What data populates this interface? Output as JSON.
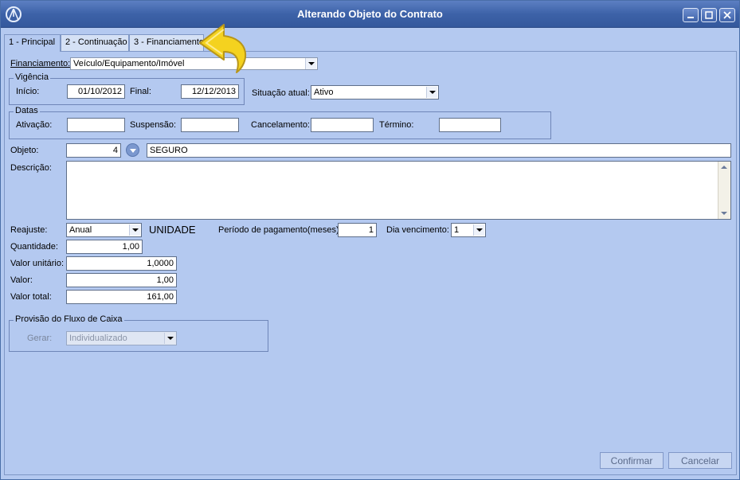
{
  "window": {
    "title": "Alterando Objeto do Contrato"
  },
  "tabs": [
    {
      "label": "1 - Principal"
    },
    {
      "label": "2 - Continuação"
    },
    {
      "label": "3 - Financiamento"
    }
  ],
  "financiamento": {
    "label": "Financiamento:",
    "value": "Veículo/Equipamento/Imóvel"
  },
  "vigencia": {
    "title": "Vigência",
    "inicio_label": "Início:",
    "inicio_value": "01/10/2012",
    "final_label": "Final:",
    "final_value": "12/12/2013"
  },
  "situacao": {
    "label": "Situação atual:",
    "value": "Ativo"
  },
  "datas": {
    "title": "Datas",
    "ativacao_label": "Ativação:",
    "ativacao_value": "",
    "suspensao_label": "Suspensão:",
    "suspensao_value": "",
    "cancelamento_label": "Cancelamento:",
    "cancelamento_value": "",
    "termino_label": "Término:",
    "termino_value": ""
  },
  "objeto": {
    "label": "Objeto:",
    "code": "4",
    "name": "SEGURO"
  },
  "descricao": {
    "label": "Descrição:",
    "value": ""
  },
  "reajuste": {
    "label": "Reajuste:",
    "value": "Anual",
    "unit": "UNIDADE"
  },
  "periodo": {
    "label": "Período de pagamento(meses):",
    "value": "1"
  },
  "vencimento": {
    "label": "Dia vencimento:",
    "value": "1"
  },
  "quantidade": {
    "label": "Quantidade:",
    "value": "1,00"
  },
  "valor_unitario": {
    "label": "Valor unitário:",
    "value": "1,0000"
  },
  "valor": {
    "label": "Valor:",
    "value": "1,00"
  },
  "valor_total": {
    "label": "Valor total:",
    "value": "161,00"
  },
  "provisao": {
    "title": "Provisão do Fluxo de Caixa",
    "gerar_label": "Gerar:",
    "gerar_value": "Individualizado"
  },
  "buttons": {
    "confirmar": "Confirmar",
    "cancelar": "Cancelar"
  },
  "colors": {
    "panel": "#b4c9f0",
    "titlebar": "#3d62a8",
    "arrow": "#f4d21f"
  }
}
